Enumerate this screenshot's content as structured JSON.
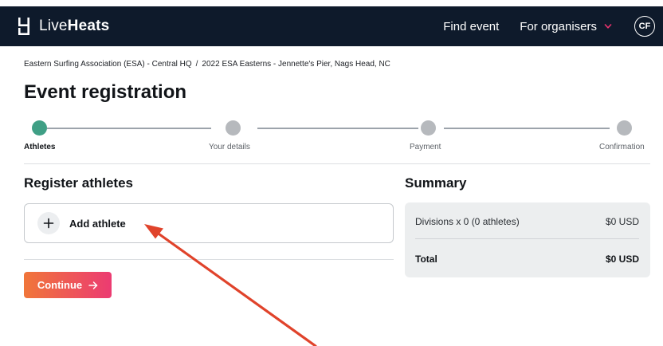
{
  "nav": {
    "brand_light": "Live",
    "brand_bold": "Heats",
    "find_event": "Find event",
    "for_organisers": "For organisers",
    "avatar_initials": "CF"
  },
  "breadcrumb": {
    "org": "Eastern Surfing Association (ESA) - Central HQ",
    "separator": "/",
    "event": "2022 ESA Easterns - Jennette's Pier, Nags Head, NC"
  },
  "page": {
    "title": "Event registration"
  },
  "steps": [
    {
      "label": "Athletes",
      "active": true
    },
    {
      "label": "Your details",
      "active": false
    },
    {
      "label": "Payment",
      "active": false
    },
    {
      "label": "Confirmation",
      "active": false
    }
  ],
  "register": {
    "title": "Register athletes",
    "add_athlete_label": "Add athlete",
    "continue_label": "Continue"
  },
  "summary": {
    "title": "Summary",
    "divisions_label": "Divisions x 0 (0 athletes)",
    "divisions_value": "$0 USD",
    "total_label": "Total",
    "total_value": "$0 USD"
  },
  "colors": {
    "nav_bg": "#0e1a2b",
    "active_step": "#3f9f85",
    "inactive_step": "#b6b9bd",
    "button_gradient_start": "#f0763a",
    "button_gradient_end": "#ec3b72",
    "annotation_arrow": "#e0432b",
    "chevron_accent": "#e8336d"
  },
  "icons": {
    "logo": "liveheats-logo-icon",
    "chevron": "chevron-down-icon",
    "plus": "plus-icon",
    "arrow": "arrow-right-icon"
  }
}
